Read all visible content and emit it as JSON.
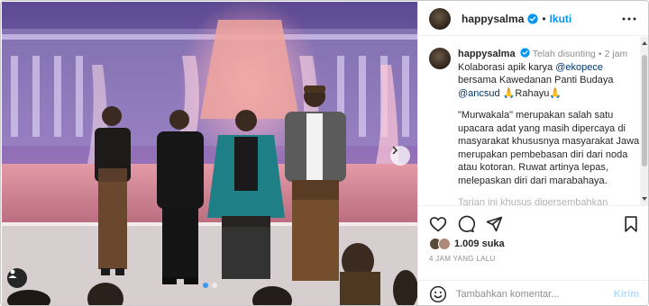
{
  "post": {
    "image_alt": "",
    "carousel": {
      "total": 2,
      "active_index": 0
    },
    "icons": {
      "user_tag": "user-icon",
      "next": "chevron-right-icon"
    }
  },
  "header": {
    "username": "happysalma",
    "separator": "•",
    "follow_label": "Ikuti",
    "icons": {
      "verified": "verified-badge-icon",
      "more": "more-options-icon"
    }
  },
  "caption": {
    "username": "happysalma",
    "edited": "Telah disunting",
    "separator": "•",
    "time": "2 jam",
    "line1_prefix": "Kolaborasi apik karya ",
    "mention1": "@ekopece",
    "line1_mid": " bersama Kawedanan Panti Budaya ",
    "mention2": "@ancsud",
    "line1_suffix": " 🙏Rahayu🙏",
    "paragraph2": "\"Murwakala\" merupakan salah satu upacara adat yang masih dipercaya di masyarakat khususnya masyarakat Jawa, merupakan pembebasan diri dari noda atau kotoran. Ruwat artinya lepas, melepaskan diri dari marabahaya.",
    "paragraph3_partial": "Tarian ini khusus dipersembahkan"
  },
  "actions": {
    "icons": {
      "like": "heart-icon",
      "comment": "comment-icon",
      "share": "send-icon",
      "save": "bookmark-icon"
    }
  },
  "likes": {
    "count": "1.009",
    "label": "suka"
  },
  "time_ago": "4 JAM YANG LALU",
  "comment": {
    "placeholder": "Tambahkan komentar...",
    "post_label": "Kirim",
    "icons": {
      "emoji": "emoji-icon"
    }
  },
  "colors": {
    "accent": "#0095f6",
    "mention": "#00376b",
    "muted": "#8e8e8e",
    "post_disabled": "#b2dffc"
  }
}
